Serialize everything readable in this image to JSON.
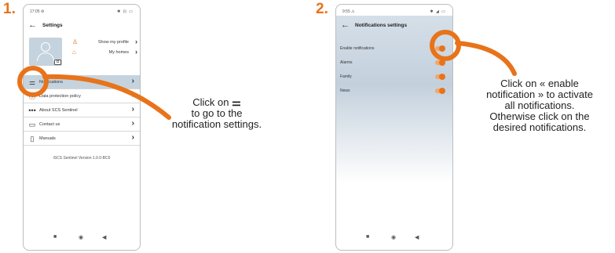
{
  "steps": {
    "one": "1.",
    "two": "2."
  },
  "phone1": {
    "status_time": "17:05 ⚙",
    "status_icons": "✱ ⊡ ▭",
    "title": "Settings",
    "show_profile": "Show my profile",
    "my_homes": "My homes",
    "menu": [
      {
        "label": "Notifications",
        "icon": "sliders-icon"
      },
      {
        "label": "Data protection policy",
        "icon": "info-icon"
      },
      {
        "label": "About SCS Sentinel",
        "icon": "dots-icon"
      },
      {
        "label": "Contact us",
        "icon": "chat-icon"
      },
      {
        "label": "Manuals",
        "icon": "document-icon"
      }
    ],
    "version": "iSCS Sentinel Version 1.0.0-BC6"
  },
  "phone2": {
    "status_time": "9:55 ⚠",
    "status_icons": "✱ ◢ ▭",
    "title": "Notifications settings",
    "rows": [
      {
        "label": "Enable notifications",
        "on": true
      },
      {
        "label": "Alarms",
        "on": true
      },
      {
        "label": "Family",
        "on": true
      },
      {
        "label": "News",
        "on": true
      }
    ]
  },
  "instructions": {
    "one_a": "Click on",
    "one_b": "to go to the",
    "one_c": "notification settings.",
    "two_a": "Click on « enable",
    "two_b": "notification » to activate",
    "two_c": "all notifications.",
    "two_d": "Otherwise click on the",
    "two_e": "desired notifications."
  },
  "colors": {
    "accent": "#e8731a",
    "highlight": "#c5d3de"
  }
}
